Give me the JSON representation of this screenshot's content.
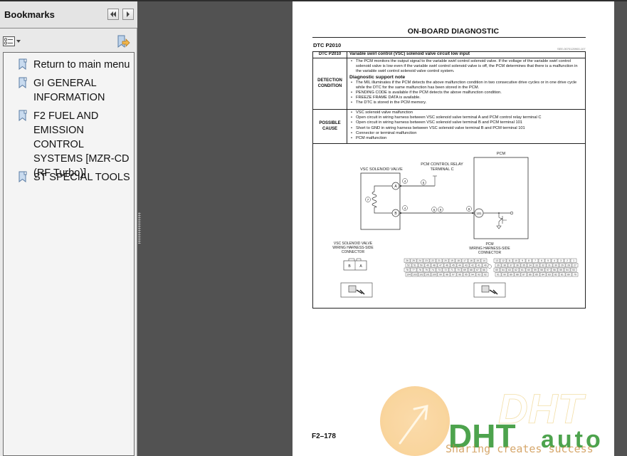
{
  "bookmarks_panel": {
    "title": "Bookmarks",
    "collapse_icon": "double-chevron-left-icon",
    "forward_icon": "chevron-right-icon",
    "options_icon": "list-options-icon",
    "expand_icon": "bookmark-expand-icon",
    "items": [
      {
        "label": "Return to main menu"
      },
      {
        "label": "GI GENERAL INFORMATION"
      },
      {
        "label": "F2 FUEL AND EMISSION CONTROL SYSTEMS [MZR-CD (RF Turbo)]"
      },
      {
        "label": "ST SPECIAL TOOLS"
      }
    ]
  },
  "document": {
    "page_heading": "ON-BOARD DIAGNOSTIC",
    "section_heading": "DTC P2010",
    "doc_id": "SEE-0070120900-107",
    "table": {
      "rows": [
        {
          "label": "DTC P2010",
          "text": "Variable swirl control (VSC) solenoid valve circuit low input"
        },
        {
          "label": "DETECTION CONDITION",
          "bullets": [
            "The PCM monitors the output signal to the variable swirl control solenoid valve. If the voltage of the variable swirl control solenoid valve is low even if the variable swirl control solenoid valve is off, the PCM determines that there is a malfunction in the variable swirl control solenoid valve control system."
          ],
          "subheading": "Diagnostic support note",
          "sub_bullets": [
            "The MIL illuminates if the PCM detects the above malfunction condition in two consecutive drive cycles or in one drive cycle while the DTC for the same malfunction has been stored in the PCM.",
            "PENDING CODE is available if the PCM detects the above malfunction condition.",
            "FREEZE FRAME DATA is available.",
            "The DTC is stored in the PCM memory."
          ]
        },
        {
          "label": "POSSIBLE CAUSE",
          "bullets": [
            "VSC solenoid valve malfunction",
            "Open circuit in wiring harness between VSC solenoid valve terminal A and PCM control relay terminal C",
            "Open circuit in wiring harness between VSC solenoid valve terminal B and PCM terminal 101",
            "Short to GND in wiring harness between VSC solenoid valve terminal B and PCM terminal 101",
            "Connector or terminal malfunction",
            "PCM malfunction"
          ]
        }
      ]
    },
    "diagram": {
      "vsc_label": "VSC SOLENOID VALVE",
      "relay_label_1": "PCM CONTROL RELAY",
      "relay_label_2": "TERMINAL C",
      "pcm_label": "PCM",
      "terminal_a": "A",
      "terminal_b": "B",
      "terminal_101": "101",
      "callout_4a": "4",
      "callout_4b": "4",
      "callout_5": "5",
      "callout_6": "6",
      "callout_7": "7",
      "callout_8": "8",
      "callout_9": "9",
      "vsc_conn_1": "VSC SOLENOID VALVE",
      "vsc_conn_2": "WIRING HARNESS-SIDE",
      "vsc_conn_3": "CONNECTOR",
      "pcm_conn_1": "PCM",
      "pcm_conn_2": "WIRING HARNESS-SIDE",
      "pcm_conn_3": "CONNECTOR",
      "conn_b": "B",
      "conn_a": "A",
      "pcm_pins_left": [
        [
          "26",
          "25",
          "24",
          "23",
          "22",
          "21",
          "20",
          "19",
          "18",
          "17",
          "16",
          "15",
          "14"
        ],
        [
          "52",
          "51",
          "50",
          "49",
          "48",
          "47",
          "46",
          "45",
          "44",
          "43",
          "42",
          "41",
          "40"
        ],
        [
          "78",
          "77",
          "76",
          "75",
          "74",
          "73",
          "72",
          "71",
          "70",
          "69",
          "68",
          "67",
          "66"
        ],
        [
          "104",
          "103",
          "102",
          "101",
          "100",
          "99",
          "98",
          "97",
          "96",
          "95",
          "94",
          "93",
          "92"
        ]
      ],
      "pcm_pins_right": [
        [
          "13",
          "12",
          "11",
          "10",
          "9",
          "8",
          "7",
          "6",
          "5",
          "4",
          "3",
          "2",
          "1"
        ],
        [
          "39",
          "38",
          "37",
          "36",
          "35",
          "34",
          "33",
          "32",
          "31",
          "30",
          "29",
          "28",
          "27"
        ],
        [
          "65",
          "64",
          "63",
          "62",
          "61",
          "60",
          "59",
          "58",
          "57",
          "56",
          "55",
          "54",
          "53"
        ],
        [
          "91",
          "90",
          "89",
          "88",
          "87",
          "86",
          "85",
          "84",
          "83",
          "82",
          "81",
          "80",
          "79"
        ]
      ]
    },
    "page_number": "F2–178"
  },
  "watermark": {
    "brand_outline": "DHT",
    "brand": "DHT",
    "brand_suffix": "auto",
    "tagline": "Sharing creates success",
    "colors": {
      "green": "#3a9a3a",
      "blue": "#2f56a8",
      "orange": "#c98a3a"
    }
  }
}
